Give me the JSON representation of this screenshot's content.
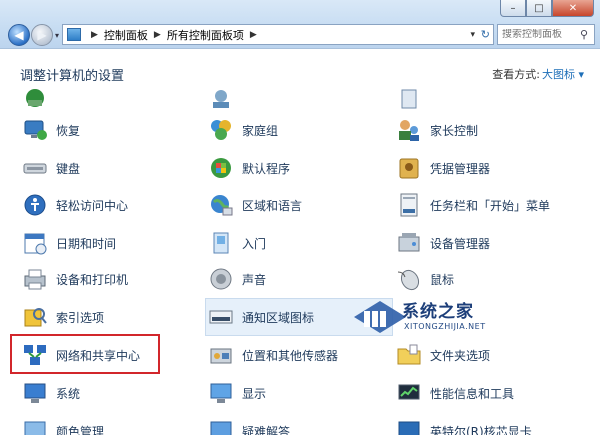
{
  "window": {
    "minimize": "–",
    "maximize": "□",
    "close": "✕"
  },
  "nav": {
    "back": "◀",
    "forward": "▶",
    "history": "▾"
  },
  "address": {
    "segments": [
      "控制面板",
      "所有控制面板项"
    ],
    "separator": "▶",
    "dropdown": "▾",
    "refresh": "↻"
  },
  "search": {
    "placeholder": "搜索控制面板",
    "icon": "search-icon"
  },
  "header": {
    "title": "调整计算机的设置",
    "view_label": "查看方式:",
    "view_value": "大图标 ▾"
  },
  "items": {
    "col1": [
      "恢复",
      "键盘",
      "轻松访问中心",
      "日期和时间",
      "设备和打印机",
      "索引选项",
      "网络和共享中心",
      "系统",
      "颜色管理"
    ],
    "col2": [
      "家庭组",
      "默认程序",
      "区域和语言",
      "入门",
      "声音",
      "通知区域图标",
      "位置和其他传感器",
      "显示",
      "疑难解答"
    ],
    "col3": [
      "家长控制",
      "凭据管理器",
      "任务栏和「开始」菜单",
      "设备管理器",
      "鼠标",
      "系统之家",
      "文件夹选项",
      "性能信息和工具",
      "英特尔(R)核芯显卡"
    ]
  },
  "watermark": {
    "text": "系统之家",
    "sub": "XITONGZHIJIA.NET"
  },
  "colors": {
    "accent": "#1e395b",
    "link": "#1e6fb8",
    "highlight": "#e6f0fa",
    "annotation": "#d2262b"
  }
}
